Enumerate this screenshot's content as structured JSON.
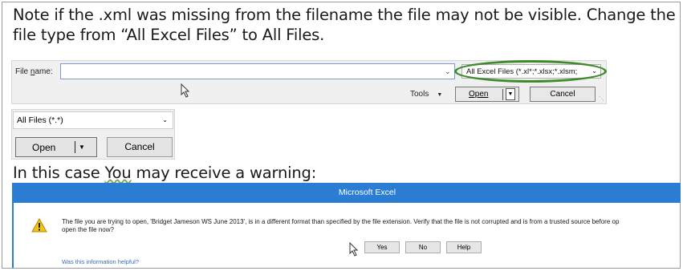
{
  "note": {
    "line1": "Note if the .xml was missing from the filename the file may not be visible. Change the",
    "line2": "file type from “All Excel Files” to All Files."
  },
  "file_dialog": {
    "filename_label_prefix": "File ",
    "filename_label_accel": "n",
    "filename_label_suffix": "ame:",
    "filename_value": "",
    "filter_value": "All Excel Files (*.xl*;*.xlsx;*.xlsm;",
    "tools_label": "Tools",
    "open_label": "Open",
    "cancel_label": "Cancel"
  },
  "file_dialog_2": {
    "filter_value": "All Files (*.*)",
    "open_label": "Open",
    "cancel_label": "Cancel"
  },
  "case": {
    "before": "In this case ",
    "wavy": "You",
    "after": " may receive a warning:"
  },
  "excel_warning": {
    "title": "Microsoft Excel",
    "message_line1": "The file you are trying to open, 'Bridget Jameson WS June 2013', is in a different format than specified by the file extension. Verify that the file is not corrupted and is from a trusted source before op",
    "message_line2": "open the file now?",
    "yes_label": "Yes",
    "no_label": "No",
    "help_label": "Help",
    "helpful_link": "Was this information helpful?"
  },
  "colors": {
    "highlight_ellipse": "#3f8a2a",
    "titlebar": "#2b7cd3"
  }
}
